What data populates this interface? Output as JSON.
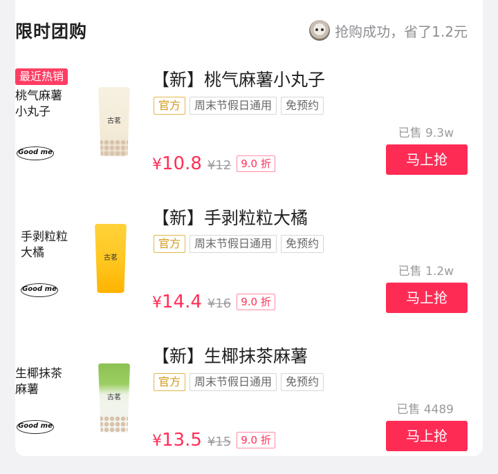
{
  "header": {
    "title": "限时团购",
    "notice": "抢购成功，省了1.2元"
  },
  "colors": {
    "accent": "#fe2c55",
    "price": "#ff2e56",
    "official_tag": "#d19a19"
  },
  "items": [
    {
      "hot_tag": "最近热销",
      "thumb_name": "桃气麻薯小丸子",
      "thumb_logo": "Good me",
      "cup_brand": "古茗",
      "name": "【新】桃气麻薯小丸子",
      "tags": [
        "官方",
        "周末节假日通用",
        "免预约"
      ],
      "sold": "已售 9.3w",
      "currency": "¥",
      "price": "10.8",
      "original_price": "¥12",
      "discount": "9.0 折",
      "button": "马上抢"
    },
    {
      "hot_tag": "",
      "thumb_name": "手剥粒粒大橘",
      "thumb_logo": "Good me",
      "cup_brand": "古茗",
      "name": "【新】手剥粒粒大橘",
      "tags": [
        "官方",
        "周末节假日通用",
        "免预约"
      ],
      "sold": "已售 1.2w",
      "currency": "¥",
      "price": "14.4",
      "original_price": "¥16",
      "discount": "9.0 折",
      "button": "马上抢"
    },
    {
      "hot_tag": "",
      "thumb_name": "生椰抹茶麻薯",
      "thumb_logo": "Good me",
      "cup_brand": "古茗",
      "name": "【新】生椰抹茶麻薯",
      "tags": [
        "官方",
        "周末节假日通用",
        "免预约"
      ],
      "sold": "已售 4489",
      "currency": "¥",
      "price": "13.5",
      "original_price": "¥15",
      "discount": "9.0 折",
      "button": "马上抢"
    }
  ]
}
